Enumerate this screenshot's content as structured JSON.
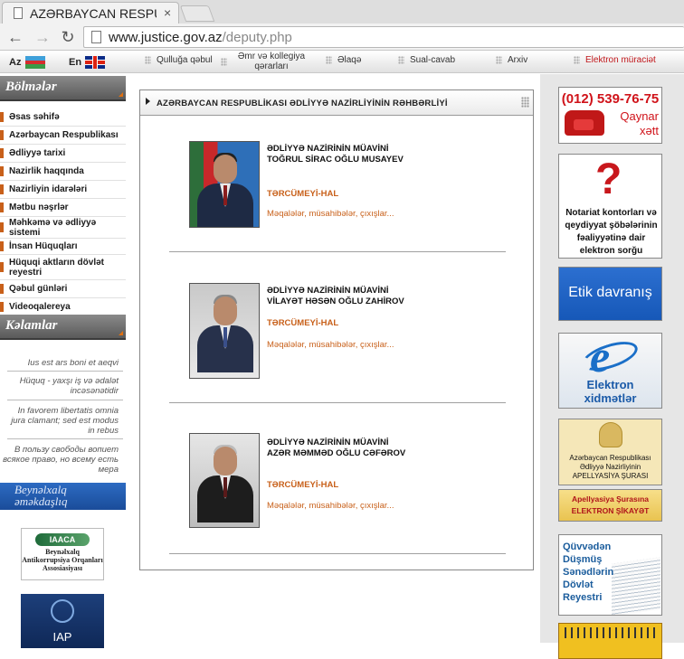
{
  "browser": {
    "tab_title": "AZƏRBAYCAN RESPU",
    "tab_close": "×",
    "url_host": "www.justice.gov.az",
    "url_path": "/deputy.php",
    "back": "←",
    "forward": "→",
    "reload": "↻"
  },
  "sitenav": {
    "lang_az": "Az",
    "lang_en": "En",
    "items": [
      "Qulluğa qəbul",
      "Əmr və kollegiya qərarları",
      "Əlaqə",
      "Sual-cavab",
      "Arxiv",
      "Elektron müraciət"
    ]
  },
  "left": {
    "sections_title": "Bölmələr",
    "menu": [
      "Əsas səhifə",
      "Azərbaycan Respublikası",
      "Ədliyyə tarixi",
      "Nazirlik haqqında",
      "Nazirliyin idarələri",
      "Mətbu nəşrlər",
      "Məhkəmə və ədliyyə sistemi",
      "İnsan Hüquqları",
      "Hüquqi aktların dövlət reyestri",
      "Qəbul günləri",
      "Videoqalereya"
    ],
    "sayings_title": "Kəlamlar",
    "sayings": [
      "Ius est ars boni et aeqvi",
      "Hüquq - yaxşı iş və ədalət incəsənətidir",
      "In favorem libertatis omnia jura clamant; sed est modus in rebus",
      "В пользу свободы вопиет всякое право, но всему есть мера"
    ],
    "intl_title": "Beynəlxalq əməkdaşlıq",
    "iaaca_logo": "IAACA",
    "iaaca_text": "Beynəlxalq Antikorrupsiya Orqanları Assosiasiyası",
    "iap_text": "IAP"
  },
  "center": {
    "header": "AZƏRBAYCAN RESPUBLİKASI ƏDLİYYƏ NAZİRLİYİNİN RƏHBƏRLİYİ",
    "deputies": [
      {
        "role": "ƏDLİYYƏ NAZİRİNİN MÜAVİNİ",
        "name": "TOĞRUL SİRAC OĞLU MUSAYEV",
        "bio": "TƏRCÜMEYİ-HAL",
        "articles": "Məqalələr, müsahibələr, çıxışlar..."
      },
      {
        "role": "ƏDLİYYƏ NAZİRİNİN MÜAVİNİ",
        "name": "VİLAYƏT HƏSƏN OĞLU ZAHİROV",
        "bio": "TƏRCÜMEYİ-HAL",
        "articles": "Məqalələr, müsahibələr, çıxışlar..."
      },
      {
        "role": "ƏDLİYYƏ NAZİRİNİN MÜAVİNİ",
        "name": "AZƏR MƏMMƏD OĞLU CƏFƏROV",
        "bio": "TƏRCÜMEYİ-HAL",
        "articles": "Məqalələr, müsahibələr, çıxışlar..."
      }
    ]
  },
  "right": {
    "hotline_number": "(012) 539-76-75",
    "hotline_label": "Qaynar xətt",
    "notary_text": "Notariat kontorları və qeydiyyat şöbələrinin fəaliyyətinə dair elektron sorğu",
    "ethics": "Etik davranış",
    "eservices": "Elektron xidmətlər",
    "appeal_council": "Azərbaycan Respublikası Ədliyyə Nazirliyinin APELLYASİYA ŞURASI",
    "appeal_complaint": "Apellyasiya Şurasına ELEKTRON ŞİKAYƏT",
    "expired_docs": "Qüvvədən Düşmüş Sənədlərin Dövlət Reyestri"
  },
  "colors": {
    "accent_orange": "#c8601a",
    "hotline_red": "#d0131a",
    "ethics_blue": "#1658b8",
    "menu_header_gray": "#6a6a6a"
  }
}
